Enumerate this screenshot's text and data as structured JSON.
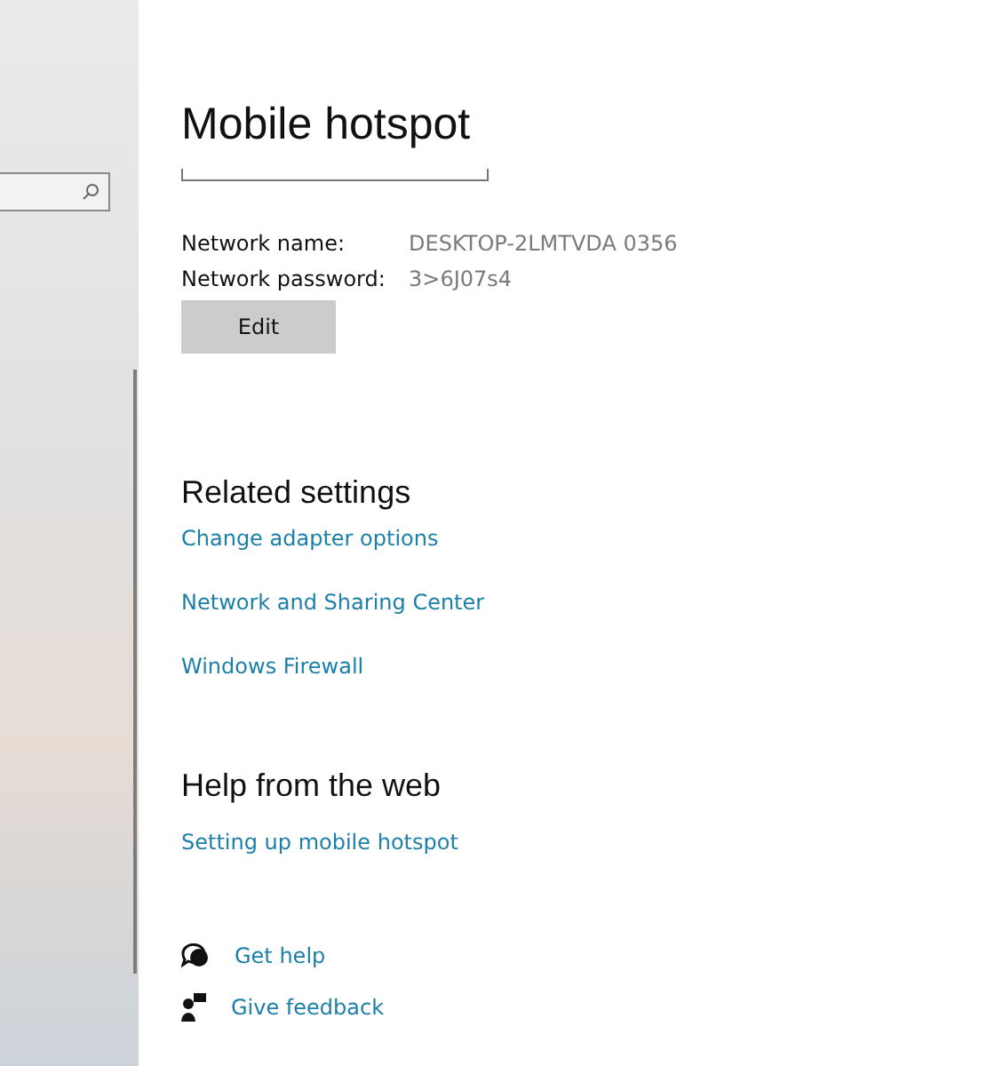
{
  "page": {
    "title": "Mobile hotspot"
  },
  "network": [
    {
      "label": "Network name:",
      "value": "DESKTOP-2LMTVDA 0356"
    },
    {
      "label": "Network password:",
      "value": "3>6J07s4"
    }
  ],
  "edit_button": "Edit",
  "related_settings": {
    "title": "Related settings",
    "links": [
      "Change adapter options",
      "Network and Sharing Center",
      "Windows Firewall"
    ]
  },
  "help": {
    "title": "Help from the web",
    "links": [
      "Setting up mobile hotspot"
    ]
  },
  "footer_links": [
    {
      "kind": "help",
      "label": "Get help"
    },
    {
      "kind": "feedback",
      "label": "Give feedback"
    }
  ]
}
